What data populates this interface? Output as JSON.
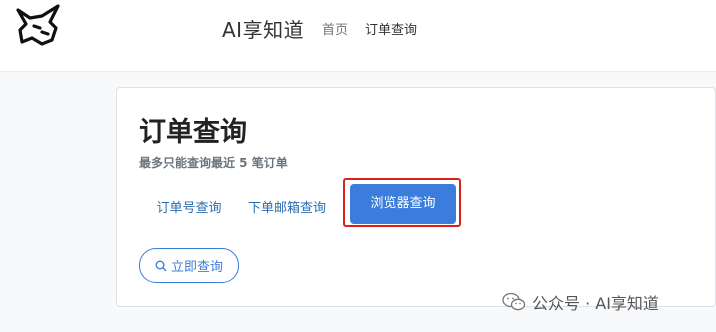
{
  "header": {
    "site_title": "AI享知道",
    "nav": {
      "home": "首页",
      "order_query": "订单查询"
    }
  },
  "card": {
    "title": "订单查询",
    "subtitle": "最多只能查询最近 5 笔订单",
    "tabs": [
      {
        "label": "订单号查询",
        "active": false
      },
      {
        "label": "下单邮箱查询",
        "active": false
      },
      {
        "label": "浏览器查询",
        "active": true
      }
    ],
    "query_button": "立即查询"
  },
  "watermark": {
    "text": "公众号 · AI享知道"
  },
  "colors": {
    "accent": "#3b7ddd",
    "highlight_border": "#d9221c",
    "link": "#2b6cb0"
  },
  "icons": {
    "logo": "unicorn-logo-icon",
    "search": "search-icon",
    "wechat": "wechat-icon"
  }
}
